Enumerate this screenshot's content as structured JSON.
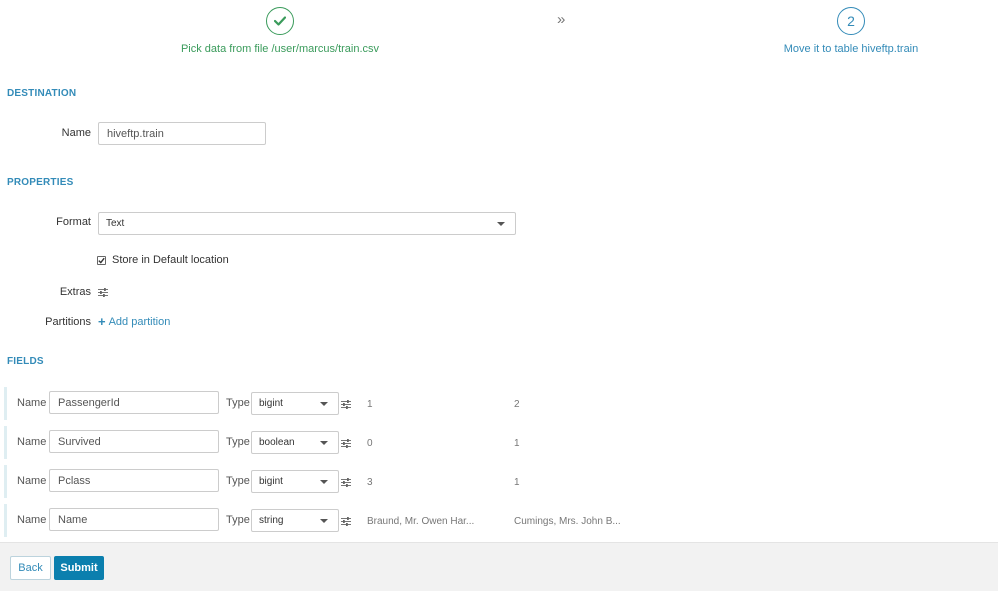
{
  "wizard": {
    "step1": {
      "label": "Pick data from file /user/marcus/train.csv",
      "icon": "check-icon"
    },
    "separator": "»",
    "step2": {
      "number": "2",
      "label": "Move it to table hiveftp.train"
    }
  },
  "destination": {
    "title": "DESTINATION",
    "name_label": "Name",
    "name_value": "hiveftp.train"
  },
  "properties": {
    "title": "PROPERTIES",
    "format_label": "Format",
    "format_value": "Text",
    "store_default_label": "Store in Default location",
    "store_default_checked": true,
    "extras_label": "Extras",
    "partitions_label": "Partitions",
    "add_partition_label": "Add partition"
  },
  "fields": {
    "title": "FIELDS",
    "name_label": "Name",
    "type_label": "Type",
    "rows": [
      {
        "name": "PassengerId",
        "type": "bigint",
        "sample1": "1",
        "sample2": "2"
      },
      {
        "name": "Survived",
        "type": "boolean",
        "sample1": "0",
        "sample2": "1"
      },
      {
        "name": "Pclass",
        "type": "bigint",
        "sample1": "3",
        "sample2": "1"
      },
      {
        "name": "Name",
        "type": "string",
        "sample1": "Braund, Mr. Owen Har...",
        "sample2": "Cumings, Mrs. John B..."
      }
    ]
  },
  "footer": {
    "back_label": "Back",
    "submit_label": "Submit"
  },
  "colors": {
    "accent": "#338bb8",
    "success": "#3a9b5b",
    "primary_button": "#0b7fae"
  }
}
